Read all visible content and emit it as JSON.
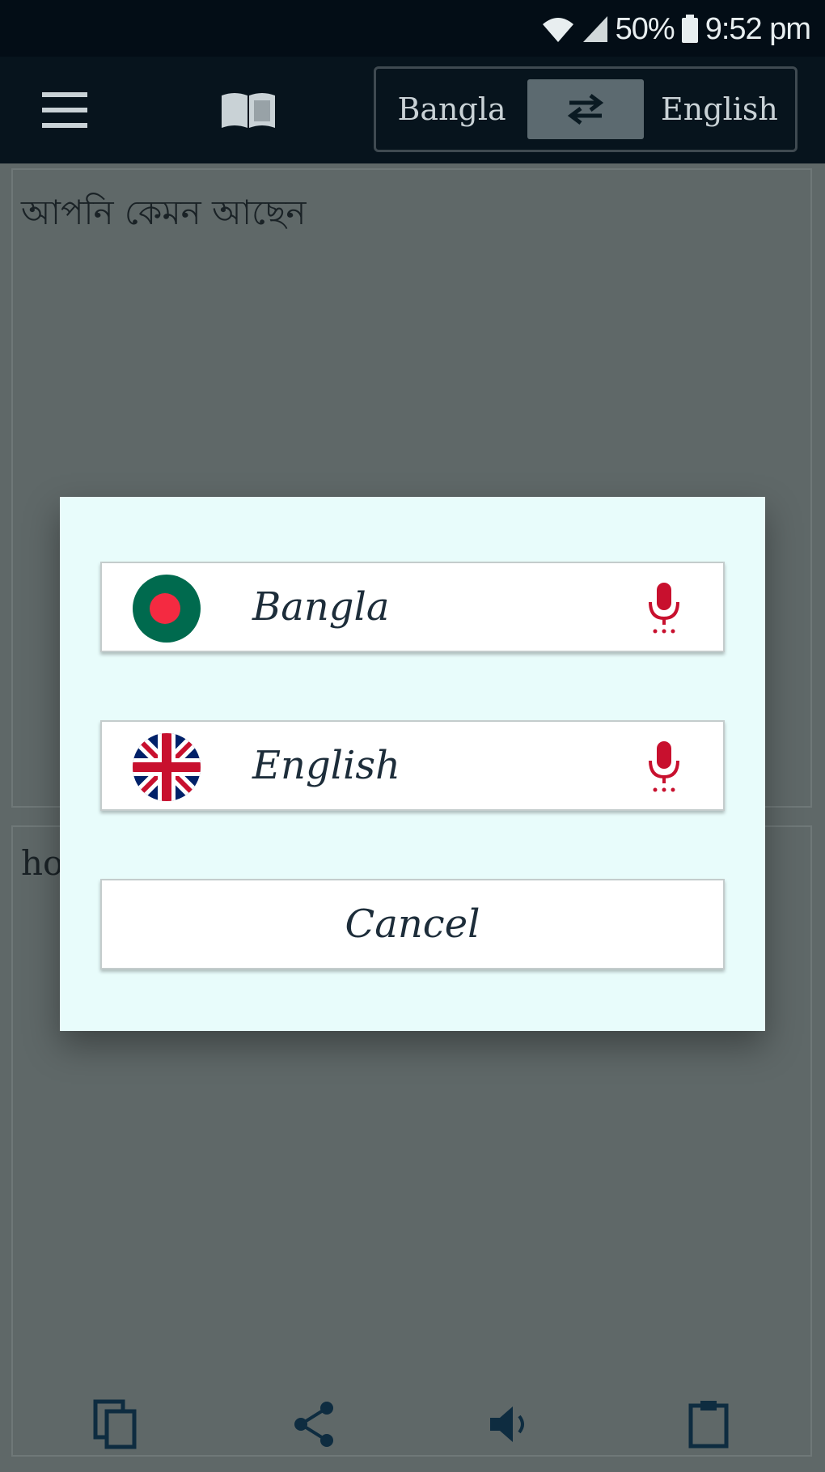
{
  "status_bar": {
    "battery": "50%",
    "time": "9:52 pm",
    "icons": [
      "wifi-icon",
      "signal-icon",
      "battery-icon"
    ]
  },
  "toolbar": {
    "source_language": "Bangla",
    "target_language": "English",
    "icons": [
      "menu-icon",
      "book-icon",
      "swap-icon"
    ]
  },
  "input_panel": {
    "text": "আপনি কেমন আছেন"
  },
  "output_panel": {
    "text": "ho"
  },
  "bottom_actions": [
    "copy-icon",
    "share-icon",
    "speaker-icon",
    "clipboard-icon"
  ],
  "dialog": {
    "options": [
      {
        "label": "Bangla",
        "flag": "bangladesh-flag-icon",
        "icon": "mic-icon"
      },
      {
        "label": "English",
        "flag": "uk-flag-icon",
        "icon": "mic-icon"
      }
    ],
    "cancel_label": "Cancel"
  },
  "colors": {
    "status_bar": "#030d16",
    "toolbar": "#07141d",
    "overlay_background": "#5f6868",
    "dialog_background": "#e8fcfb",
    "mic_red": "#c8102e",
    "bangladesh_green": "#006a4e",
    "bangladesh_red": "#f42a41"
  }
}
